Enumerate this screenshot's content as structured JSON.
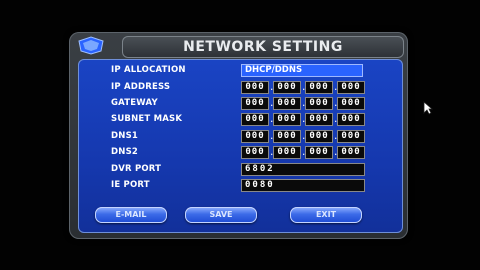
{
  "dialog": {
    "title": "NETWORK SETTING"
  },
  "fields": {
    "ip_allocation": {
      "label": "IP ALLOCATION",
      "value": "DHCP/DDNS"
    },
    "ip_address": {
      "label": "IP ADDRESS",
      "octets": [
        "000",
        "000",
        "000",
        "000"
      ]
    },
    "gateway": {
      "label": "GATEWAY",
      "octets": [
        "000",
        "000",
        "000",
        "000"
      ]
    },
    "subnet_mask": {
      "label": "SUBNET MASK",
      "octets": [
        "000",
        "000",
        "000",
        "000"
      ]
    },
    "dns1": {
      "label": "DNS1",
      "octets": [
        "000",
        "000",
        "000",
        "000"
      ]
    },
    "dns2": {
      "label": "DNS2",
      "octets": [
        "000",
        "000",
        "000",
        "000"
      ]
    },
    "dvr_port": {
      "label": "DVR PORT",
      "value": "6802"
    },
    "ie_port": {
      "label": "IE PORT",
      "value": "0080"
    }
  },
  "separators": ".",
  "buttons": {
    "email": "E-MAIL",
    "save": "SAVE",
    "exit": "EXIT"
  },
  "colors": {
    "panel": "#1538ae",
    "selected_field": "#2a63ff",
    "button": "#3c6be8"
  }
}
